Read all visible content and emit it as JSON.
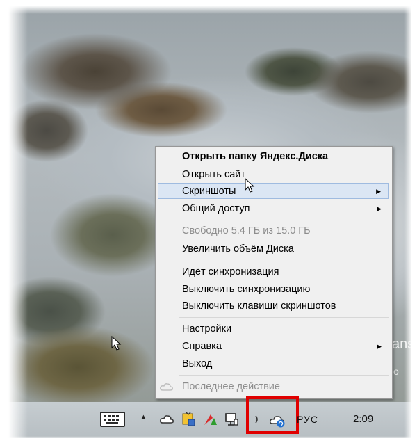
{
  "menu": {
    "items": [
      {
        "label": "Открыть папку Яндекс.Диска",
        "bold": true
      },
      {
        "label": "Открыть сайт"
      },
      {
        "label": "Скриншоты",
        "submenu": true,
        "highlighted": true
      },
      {
        "label": "Общий доступ",
        "submenu": true
      },
      {
        "label": "Свободно 5.4 ГБ из 15.0 ГБ",
        "disabled": true
      },
      {
        "label": "Увеличить объём Диска"
      },
      {
        "label": "Идёт синхронизация"
      },
      {
        "label": "Выключить синхронизацию"
      },
      {
        "label": "Выключить клавиши скриншотов"
      },
      {
        "label": "Настройки"
      },
      {
        "label": "Справка",
        "submenu": true
      },
      {
        "label": "Выход"
      },
      {
        "label": "Последнее действие",
        "disabled": true
      }
    ],
    "submenu_arrow": "▶"
  },
  "background_text": {
    "fragment_1": "ans",
    "fragment_2": "o"
  },
  "taskbar": {
    "show_hidden_icons": "▲",
    "language": "РУС",
    "clock": "2:09",
    "tray_icons": [
      "onedrive-cloud-icon",
      "updates-shield-icon",
      "antivirus-icon",
      "network-icon",
      "volume-icon",
      "yandex-disk-sync-icon"
    ]
  },
  "colors": {
    "highlight_box": "#e00000",
    "menu_highlight": "#dbe6f4"
  }
}
